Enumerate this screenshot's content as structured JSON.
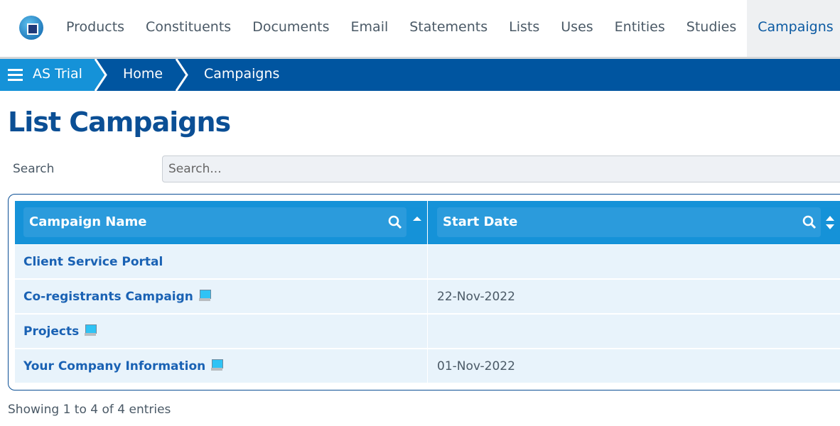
{
  "nav": {
    "items": [
      "Products",
      "Constituents",
      "Documents",
      "Email",
      "Statements",
      "Lists",
      "Uses",
      "Entities",
      "Studies",
      "Campaigns"
    ],
    "active": "Campaigns"
  },
  "breadcrumb": [
    "AS Trial",
    "Home",
    "Campaigns"
  ],
  "page_title": "List Campaigns",
  "search": {
    "label": "Search",
    "placeholder": "Search...",
    "value": ""
  },
  "table": {
    "columns": [
      {
        "label": "Campaign Name",
        "sort": "ascending"
      },
      {
        "label": "Start Date",
        "sort": "none"
      }
    ],
    "rows": [
      {
        "name": "Client Service Portal",
        "icon": "",
        "date": ""
      },
      {
        "name": "Co-registrants Campaign",
        "icon": "laptop-icon",
        "date": "22-Nov-2022"
      },
      {
        "name": "Projects",
        "icon": "desktop-icon",
        "date": ""
      },
      {
        "name": "Your Company Information",
        "icon": "laptop-icon",
        "date": "01-Nov-2022"
      }
    ]
  },
  "footer": "Showing 1 to 4 of 4 entries",
  "colors": {
    "primary": "#0055a0",
    "accent": "#1592d8",
    "title": "#0b4f95",
    "link": "#1a62b4"
  }
}
